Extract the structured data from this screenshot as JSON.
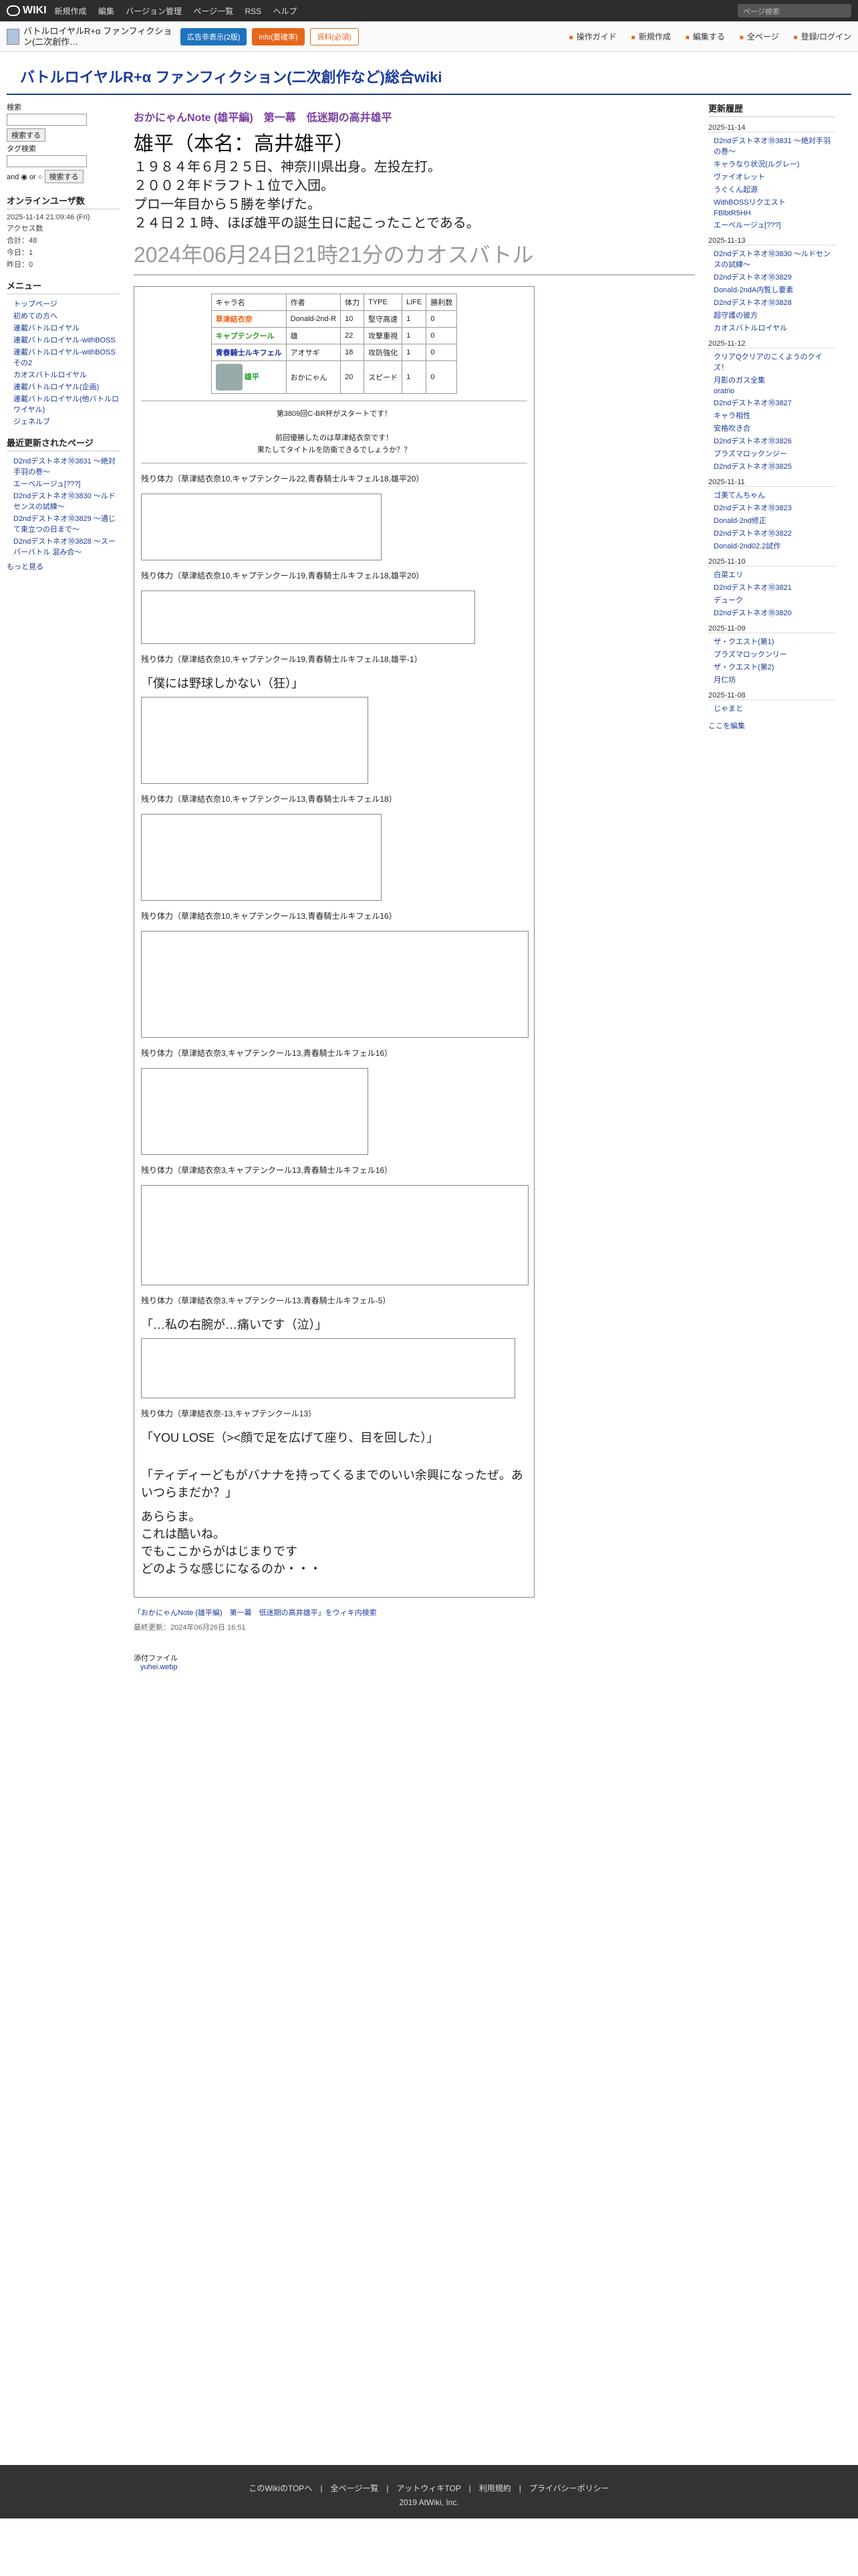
{
  "top": {
    "brand": "WIKI",
    "menu": [
      "新規作成",
      "編集",
      "バージョン管理",
      "ページ一覧",
      "RSS",
      "ヘルプ"
    ],
    "search": "ページ検索"
  },
  "header": {
    "site": "バトルロイヤルR+α ファンフィクション(二次創作…",
    "b1": "広告非表示(2版)",
    "b2": "info(要確率)",
    "b3": "資料(必須)",
    "nav": [
      "操作ガイド",
      "新規作成",
      "編集する",
      "全ページ",
      "登録/ログイン"
    ]
  },
  "page_title": "バトルロイヤルR+α ファンフィクション(二次創作など)総合wiki",
  "left": {
    "search_label": "検索",
    "search_btn": "検索する",
    "tag_label": "タグ検索",
    "and_or": "and ◉ or ○",
    "search_btn2": "検索する",
    "online": "オンラインユーザ数",
    "stats": [
      "2025-11-14 21:09:46 (Fri)",
      "アクセス数",
      "合計：48",
      "今日：1",
      "昨日：0"
    ],
    "menu_h": "メニュー",
    "menu": [
      "トップページ",
      "初めての方へ",
      "連載バトルロイヤル",
      "連載バトルロイヤル-withBOSS",
      "連載バトルロイヤル-withBOSSその2",
      "カオスバトルロイヤル",
      "連載バトルロイヤル(企画)",
      "連載バトルロイヤル(他バトルロワイヤル)",
      "ジェネルブ"
    ],
    "recent_h": "最近更新されたページ",
    "recent": [
      "D2ndデストネオ⑩3831 〜絶対手羽の巻〜",
      "エーベルージュ[???]",
      "D2ndデストネオ⑩3830 〜ルドセンスの試練〜",
      "D2ndデストネオ⑩3829 〜通じて東立つの日まで〜",
      "D2ndデストネオ⑩3828 〜スーパーバトル 混み合〜"
    ],
    "more": "もっと見る"
  },
  "main": {
    "sub": "おかにゃんNote (雄平編)　第一幕　低迷期の高井雄平",
    "name": "雄平（本名：高井雄平）",
    "intro": [
      "１９８４年６月２５日、神奈川県出身。左投左打。",
      "２００２年ドラフト１位で入団。",
      "プロ一年目から５勝を挙げた。",
      "２４日２１時、ほぼ雄平の誕生日に起こったことである。"
    ],
    "chaos": "2024年06月24日21時21分のカオスバトル",
    "table_head": [
      "キャラ名",
      "作者",
      "体力",
      "TYPE",
      "LIFE",
      "勝利数"
    ],
    "table": [
      [
        "草津結衣奈",
        "Donald-2nd-R",
        "10",
        "堅守高速",
        "1",
        "0"
      ],
      [
        "キャプテンクール",
        "雄",
        "22",
        "攻撃重視",
        "1",
        "0"
      ],
      [
        "青春騎士ルキフェル",
        "アオサギ",
        "18",
        "攻防強化",
        "1",
        "0"
      ],
      [
        "雄平",
        "おかにゃん",
        "20",
        "スピード",
        "1",
        "0"
      ]
    ],
    "start": [
      "第3809回C-BR杯がスタートです！",
      "前回優勝したのは草津結衣奈です！",
      "果たしてタイトルを防衛できるでしょうか？？"
    ],
    "hp_lines": [
      "残り体力（草津結衣奈10,キャプテンクール22,青春騎士ルキフェル18,雄平20）",
      "残り体力（草津結衣奈10,キャプテンクール19,青春騎士ルキフェル18,雄平20）",
      "残り体力（草津結衣奈10,キャプテンクール19,青春騎士ルキフェル18,雄平-1）",
      "残り体力（草津結衣奈10,キャプテンクール13,青春騎士ルキフェル18）",
      "残り体力（草津結衣奈10,キャプテンクール13,青春騎士ルキフェル16）",
      "残り体力（草津結衣奈3,キャプテンクール13,青春騎士ルキフェル16）",
      "残り体力（草津結衣奈3,キャプテンクール13,青春騎士ルキフェル16）",
      "残り体力（草津結衣奈3,キャプテンクール13,青春騎士ルキフェル-5）",
      "残り体力（草津結衣奈-13,キャプテンクール13）"
    ],
    "quote1": "「僕には野球しかない（狂）」",
    "quote2": "「…私の右腕が…痛いです（泣）」",
    "quote3": "「YOU LOSE（><顔で足を広げて座り、目を回した）」",
    "quote4": "「ティディーどもがバナナを持ってくるまでのいい余興になったぜ。あいつらまだか？」",
    "ending": [
      "あららま。",
      "これは酷いね。",
      "でもここからがはじまりです",
      "どのような感じになるのか・・・"
    ],
    "crumb": "「おかにゃんNote (雄平編)　第一幕　低迷期の高井雄平」をウィキ内検索",
    "updated": "最終更新：2024年06月26日 16:51",
    "attach": "添付ファイル",
    "file": "yuhei.webp"
  },
  "right": {
    "h": "更新履歴",
    "dates": [
      "2025-11-14",
      "2025-11-13",
      "2025-11-12",
      "2025-11-11",
      "2025-11-10",
      "2025-11-09",
      "2025-11-08"
    ],
    "items": [
      [
        "D2ndデストネオ⑩3831 〜絶対手羽の巻〜",
        "キャラなり状況(ルグレー)",
        "ヴァイオレット",
        "うぐくん起源",
        "WithBOSSリクエスト",
        "FBlbtR5HH",
        "エーベルージュ[???]"
      ],
      [
        "D2ndデストネオ⑩3830 〜ルドセンスの試練〜",
        "D2ndデストネオ⑩3829",
        "Donald-2ndA内覧し要素",
        "D2ndデストネオ⑩3828",
        "超守護の彼方",
        "カオスバトルロイヤル"
      ],
      [
        "クリアQクリアのこくようのクイズ！",
        "月影のガス全集",
        "oratrio",
        "D2ndデストネオ⑩3827",
        "キャラ相性",
        "安格吹き合",
        "D2ndデストネオ⑩3826",
        "プラズマロックンジー",
        "D2ndデストネオ⑩3825"
      ],
      [
        "ゴ美てんちゃん",
        "D2ndデストネオ⑩3823",
        "Donald-2nd修正",
        "D2ndデストネオ⑩3822",
        "Donald-2nd02.2試作"
      ],
      [
        "白菜エリ",
        "D2ndデストネオ⑩3821",
        "デューク",
        "D2ndデストネオ⑩3820"
      ],
      [
        "ザ・クエスト(第1)",
        "プラズマロックンリー",
        "ザ・クエスト(第2)",
        "月仁坊"
      ],
      [
        "じゃまと"
      ]
    ],
    "edit": "ここを編集"
  },
  "footer": {
    "links": "このWikiのTOPへ　|　全ページ一覧　|　アットウィキTOP　|　利用規約　|　プライバシーポリシー",
    "copy": "2019 AtWiki, Inc."
  }
}
